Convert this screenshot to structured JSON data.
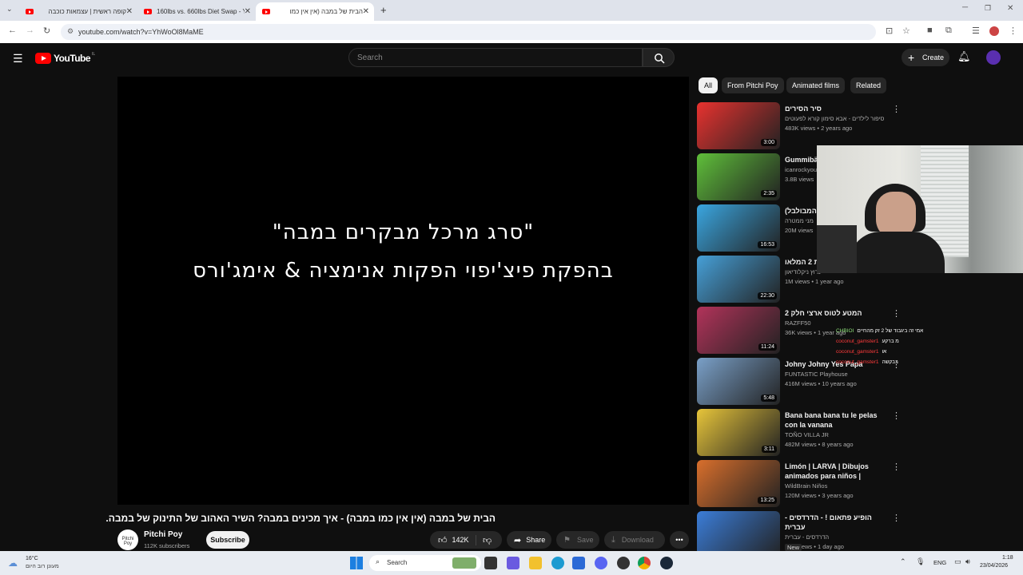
{
  "tabs": [
    {
      "title": "קופה ראשית | עצמאות כוכבה"
    },
    {
      "title": "160lbs vs. 660lbs Diet Swap - Y"
    },
    {
      "title": "הבית של במבה (אין אין כמו"
    }
  ],
  "new_tab": "+",
  "address": "youtube.com/watch?v=YhWoOl8MaME",
  "header": {
    "logo_text": "YouTube",
    "region": "IL",
    "search_placeholder": "Search",
    "create_label": "Create"
  },
  "video": {
    "line1": "\"סרג מרכל מבקרים במבה\"",
    "line2": "בהפקת פיצ'יפוי הפקות אנימציה & אימג'ורס",
    "title": "הבית של במבה (אין אין כמו במבה) - איך מכינים במבה? השיר האהוב של התינוק של במבה."
  },
  "channel": {
    "name": "Pitchi Poy",
    "subs": "112K subscribers",
    "avatar_text": "Pitchi Poy",
    "subscribe_label": "Subscribe"
  },
  "actions": {
    "likes": "142K",
    "share": "Share",
    "save": "Save",
    "download": "Download"
  },
  "chips": [
    "All",
    "From Pitchi Poy",
    "Animated films",
    "Related"
  ],
  "recommendations": [
    {
      "title": "סיר הסירים",
      "channel": "סיפור לילדים - אבא סימון קורא לפעוטים",
      "meta": "483K views • 2 years ago",
      "duration": "3:00",
      "color": "#e8322f"
    },
    {
      "title": "Gummibär Song - Lor",
      "channel": "icanrockyou",
      "meta": "3.8B views",
      "duration": "2:35",
      "color": "#5fbf3a"
    },
    {
      "title": "המערכונים (המבולבל)",
      "channel": "מני ממטרה",
      "meta": "20M views",
      "duration": "16:53",
      "color": "#3aa6e0"
    },
    {
      "title": "קציצות 2 המלאו",
      "channel": "ערוץ ניקלודיאון",
      "meta": "1M views • 1 year ago",
      "duration": "22:30",
      "color": "#46a0d8"
    },
    {
      "title": "המטע לטוס ארצי חלק 2",
      "channel": "RAZFF50",
      "meta": "36K views • 1 year ago",
      "duration": "11:24",
      "color": "#b2335a"
    },
    {
      "title": "Johny Johny Yes Papa",
      "channel": "FUNTASTIC Playhouse",
      "meta": "416M views • 10 years ago",
      "duration": "5:48",
      "color": "#7aa0c8"
    },
    {
      "title": "Bana bana bana tu le pelas con la vanana",
      "channel": "TOÑO VILLA JR",
      "meta": "482M views • 8 years ago",
      "duration": "3:11",
      "color": "#e7c53a"
    },
    {
      "title": "Limón | LARVA | Dibujos animados para niños | WildBra...",
      "channel": "WildBrain Niños",
      "meta": "120M views • 3 years ago",
      "duration": "13:25",
      "color": "#d96f2c"
    },
    {
      "title": "הופיע פתאום ! - הדרדסים - עברית",
      "channel": "הדרדסים - עברית",
      "meta": "24K views • 1 day ago",
      "duration": "",
      "badge": "New",
      "color": "#3b7dd8"
    }
  ],
  "chat": [
    {
      "user": "CHBIOI",
      "text": "אמי זה ביגבוד של 2 זק מהחיים"
    },
    {
      "user": "coconut_gamster1",
      "text": "מ ברקע"
    },
    {
      "user": "coconut_gamster1",
      "text": "או"
    },
    {
      "user": "coconut_gamster1",
      "text": "בבקשה"
    }
  ],
  "taskbar": {
    "weather_temp": "16°C",
    "weather_desc": "מעונן רוב היום",
    "search_label": "Search",
    "lang": "ENG",
    "time": "1:18",
    "date": "23/04/2026"
  }
}
